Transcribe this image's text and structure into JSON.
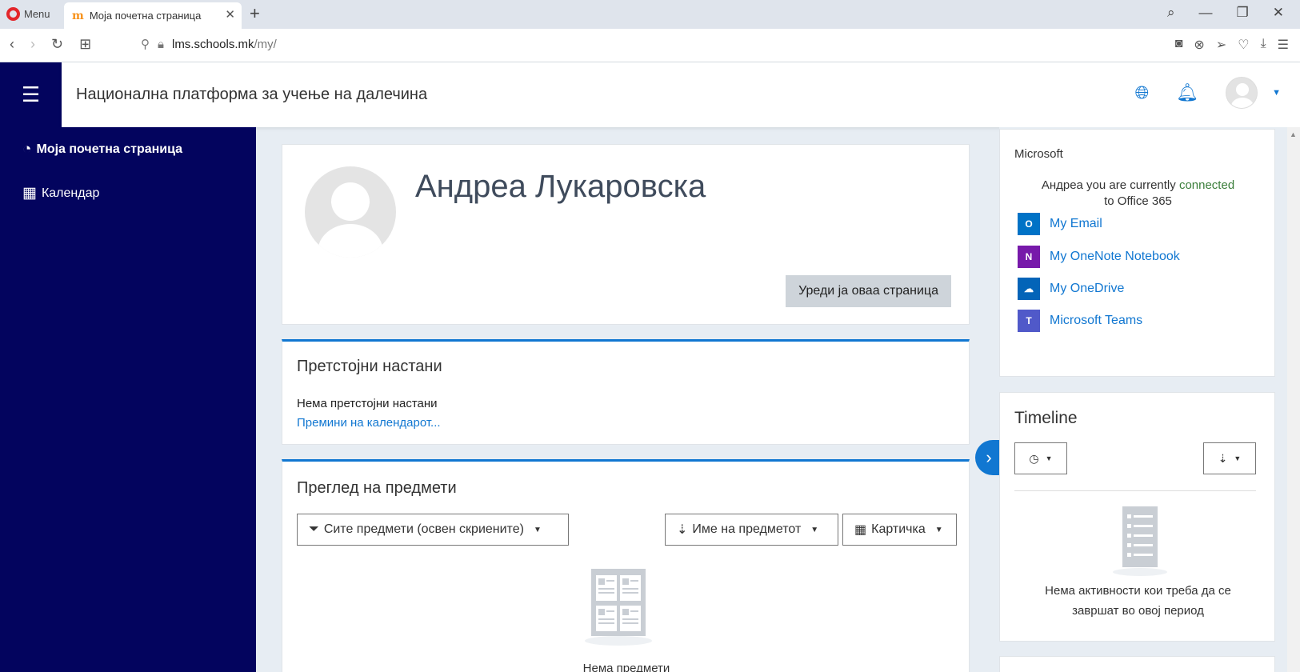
{
  "browser": {
    "menu_label": "Menu",
    "tab_title": "Моја почетна страница",
    "url_host": "lms.schools.mk",
    "url_path": "/my/"
  },
  "header": {
    "site_title": "Национална платформа за учење на далечина"
  },
  "drawer": {
    "items": [
      {
        "label": "Моја почетна страница",
        "icon": "dashboard-icon",
        "active": true
      },
      {
        "label": "Календар",
        "icon": "calendar-icon",
        "active": false
      }
    ]
  },
  "profile": {
    "name": "Андреа Лукаровска",
    "edit_button": "Уреди ја оваа страница"
  },
  "events": {
    "title": "Претстојни настани",
    "empty_text": "Нема претстојни настани",
    "calendar_link": "Премини на календарот..."
  },
  "courses": {
    "title": "Преглед на предмети",
    "filter_label": "Сите предмети (освен скриените)",
    "sort_label": "Име на предметот",
    "view_label": "Картичка",
    "empty_text": "Нема предмети"
  },
  "microsoft": {
    "title": "Microsoft",
    "connected_prefix": "Андреа you are currently",
    "connected_word": "connected",
    "connected_suffix": "to Office 365",
    "links": [
      {
        "label": "My Email",
        "icon": "outlook-icon",
        "color": "#0072c6",
        "glyph": "O"
      },
      {
        "label": "My OneNote Notebook",
        "icon": "onenote-icon",
        "color": "#7719aa",
        "glyph": "N"
      },
      {
        "label": "My OneDrive",
        "icon": "onedrive-icon",
        "color": "#0364b8",
        "glyph": "☁"
      },
      {
        "label": "Microsoft Teams",
        "icon": "teams-icon",
        "color": "#5059c9",
        "glyph": "T"
      }
    ]
  },
  "timeline": {
    "title": "Timeline",
    "empty_text": "Нема активности кои треба да се завршат во овој период"
  },
  "colors": {
    "drawer_bg": "#03045e",
    "accent": "#1177d1",
    "page_bg": "#e7edf3"
  }
}
